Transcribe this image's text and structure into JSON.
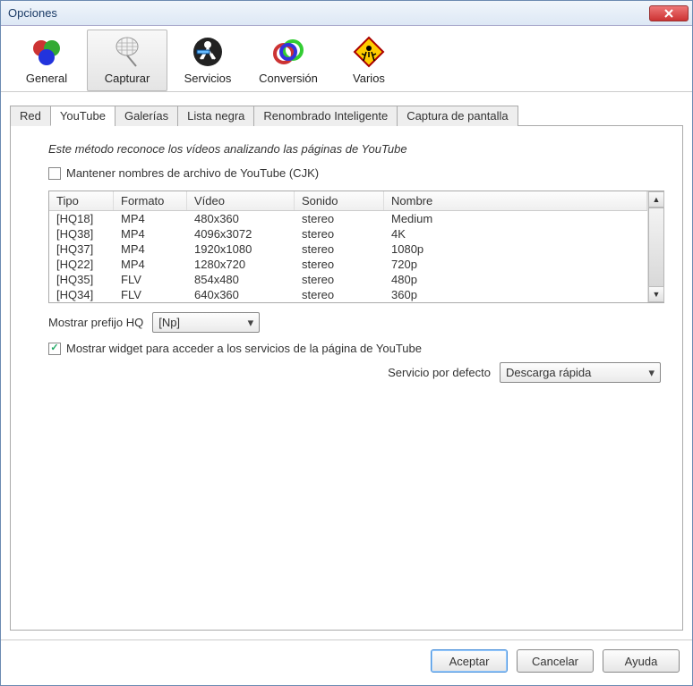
{
  "window": {
    "title": "Opciones"
  },
  "toolbar": [
    {
      "id": "general",
      "label": "General",
      "selected": false
    },
    {
      "id": "capturar",
      "label": "Capturar",
      "selected": true
    },
    {
      "id": "servicios",
      "label": "Servicios",
      "selected": false
    },
    {
      "id": "conversion",
      "label": "Conversión",
      "selected": false
    },
    {
      "id": "varios",
      "label": "Varios",
      "selected": false
    }
  ],
  "tabs": [
    {
      "id": "red",
      "label": "Red",
      "active": false
    },
    {
      "id": "youtube",
      "label": "YouTube",
      "active": true
    },
    {
      "id": "galerias",
      "label": "Galerías",
      "active": false
    },
    {
      "id": "listanegra",
      "label": "Lista negra",
      "active": false
    },
    {
      "id": "renombrado",
      "label": "Renombrado Inteligente",
      "active": false
    },
    {
      "id": "captura",
      "label": "Captura de pantalla",
      "active": false
    }
  ],
  "desc": "Este método reconoce los vídeos analizando las páginas de YouTube",
  "chk_cjk": {
    "label": "Mantener nombres de archivo de YouTube (CJK)",
    "checked": false
  },
  "table": {
    "headers": {
      "tipo": "Tipo",
      "formato": "Formato",
      "video": "Vídeo",
      "sonido": "Sonido",
      "nombre": "Nombre"
    },
    "rows": [
      {
        "tipo": "[HQ18]",
        "formato": "MP4",
        "video": "480x360",
        "sonido": "stereo",
        "nombre": "Medium"
      },
      {
        "tipo": "[HQ38]",
        "formato": "MP4",
        "video": "4096x3072",
        "sonido": "stereo",
        "nombre": "4K"
      },
      {
        "tipo": "[HQ37]",
        "formato": "MP4",
        "video": "1920x1080",
        "sonido": "stereo",
        "nombre": "1080p"
      },
      {
        "tipo": "[HQ22]",
        "formato": "MP4",
        "video": "1280x720",
        "sonido": "stereo",
        "nombre": "720p"
      },
      {
        "tipo": "[HQ35]",
        "formato": "FLV",
        "video": "854x480",
        "sonido": "stereo",
        "nombre": "480p"
      },
      {
        "tipo": "[HQ34]",
        "formato": "FLV",
        "video": "640x360",
        "sonido": "stereo",
        "nombre": "360p"
      }
    ]
  },
  "prefix": {
    "label": "Mostrar prefijo HQ",
    "value": "[Np]"
  },
  "chk_widget": {
    "label": "Mostrar widget para acceder a los servicios de la página de YouTube",
    "checked": true
  },
  "service_default": {
    "label": "Servicio por defecto",
    "value": "Descarga rápida"
  },
  "buttons": {
    "accept": "Aceptar",
    "cancel": "Cancelar",
    "help": "Ayuda"
  }
}
